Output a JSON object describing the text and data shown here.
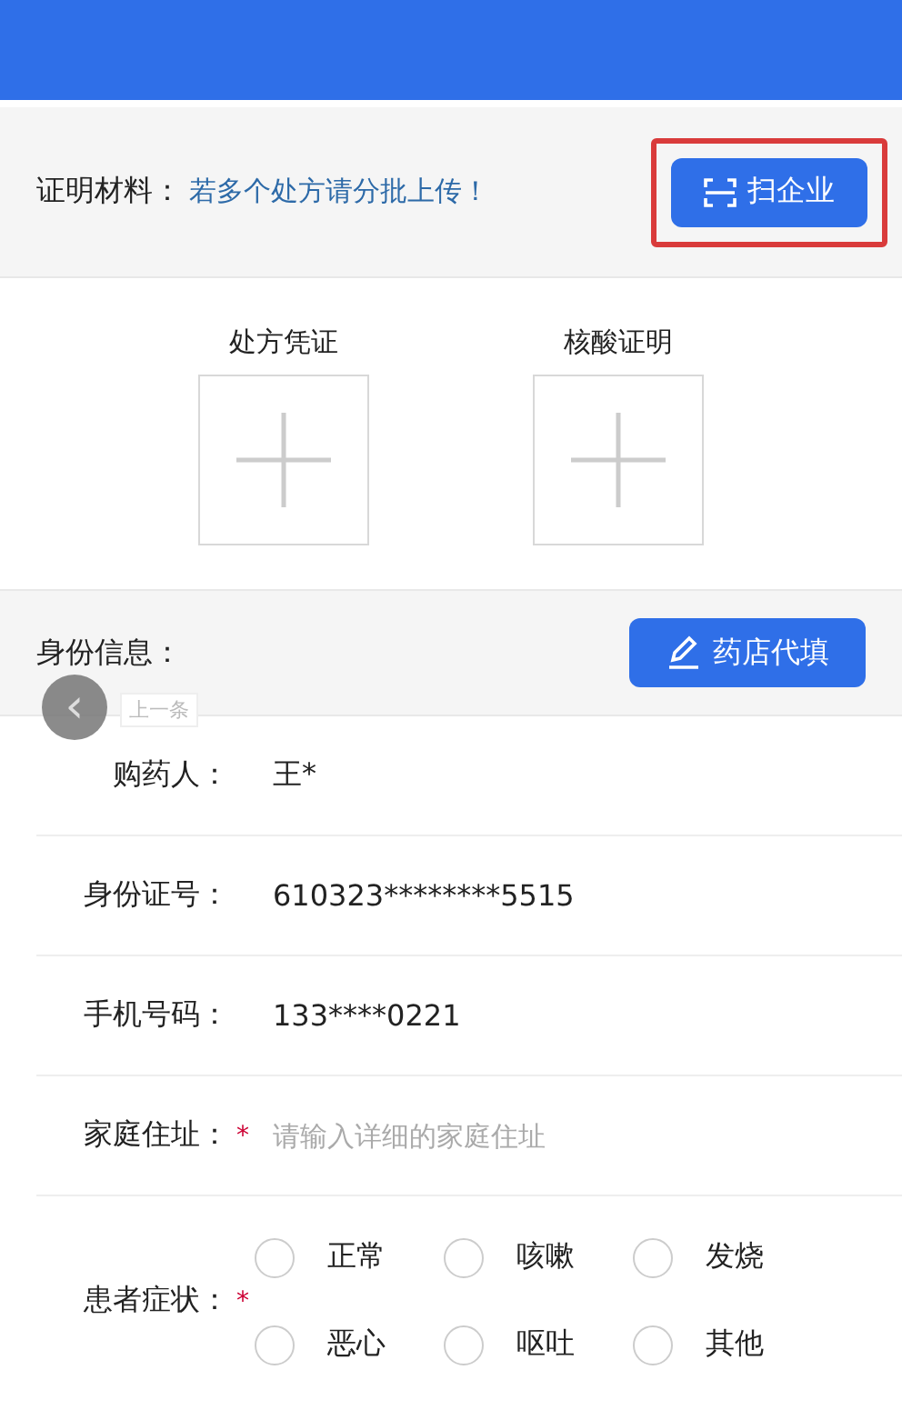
{
  "materials": {
    "label": "证明材料：",
    "hint": "若多个处方请分批上传！",
    "scan_button": "扫企业",
    "scan_button_highlighted": true
  },
  "uploads": [
    {
      "label": "处方凭证"
    },
    {
      "label": "核酸证明"
    }
  ],
  "identity": {
    "label": "身份信息：",
    "fill_button": "药店代填"
  },
  "prev_nav": {
    "symbol": "‹",
    "tooltip": "上一条"
  },
  "fields": [
    {
      "label": "购药人：",
      "value": "王*"
    },
    {
      "label": "身份证号：",
      "value": "610323********5515"
    },
    {
      "label": "手机号码：",
      "value": "133****0221"
    },
    {
      "label": "家庭住址：",
      "required_mark": "*",
      "placeholder": "请输入详细的家庭住址"
    }
  ],
  "symptoms": {
    "label": "患者症状：",
    "required_mark": "*",
    "options": [
      {
        "label": "正常",
        "checked": false
      },
      {
        "label": "咳嗽",
        "checked": false
      },
      {
        "label": "发烧",
        "checked": false
      },
      {
        "label": "恶心",
        "checked": false
      },
      {
        "label": "呕吐",
        "checked": false
      },
      {
        "label": "其他",
        "checked": false
      }
    ]
  }
}
